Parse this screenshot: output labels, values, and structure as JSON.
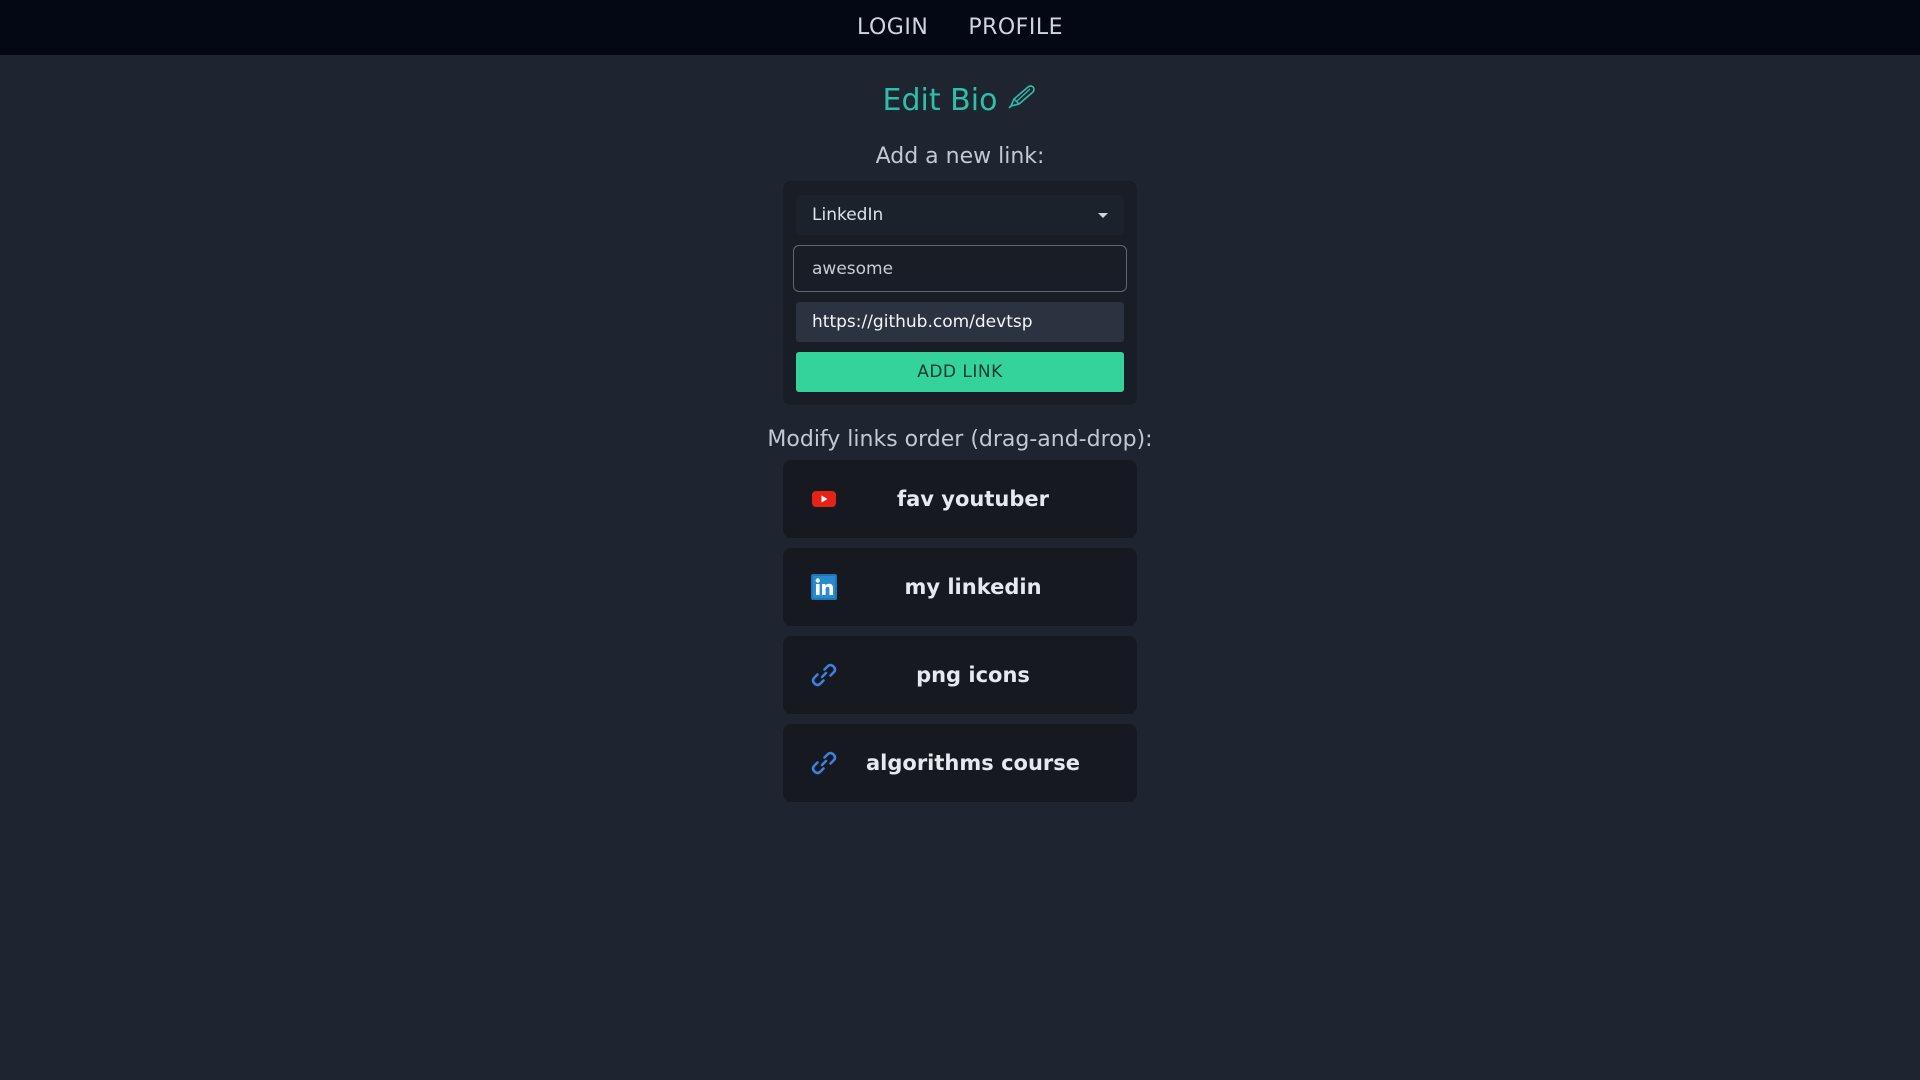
{
  "nav": {
    "login_label": "LOGIN",
    "profile_label": "PROFILE"
  },
  "header": {
    "title": "Edit Bio",
    "title_icon": "pencil-icon"
  },
  "add_link": {
    "section_label": "Add a new link:",
    "platform_select": {
      "selected": "LinkedIn"
    },
    "title_input": {
      "value": "awesome"
    },
    "url_input": {
      "value": "https://github.com/devtsp"
    },
    "submit_label": "ADD LINK"
  },
  "links": {
    "section_label": "Modify links order (drag-and-drop):",
    "items": [
      {
        "label": "fav youtuber",
        "icon": "youtube-icon"
      },
      {
        "label": "my linkedin",
        "icon": "linkedin-icon"
      },
      {
        "label": "png icons",
        "icon": "link-icon"
      },
      {
        "label": "algorithms course",
        "icon": "link-icon"
      }
    ]
  },
  "colors": {
    "accent": "#2dbfa8",
    "button": "#34d39b",
    "background": "#1e2430",
    "topbar": "#030814",
    "youtube": "#e62117",
    "linkedin": "#1b77b5",
    "link_icon": "#3f7fe0"
  }
}
